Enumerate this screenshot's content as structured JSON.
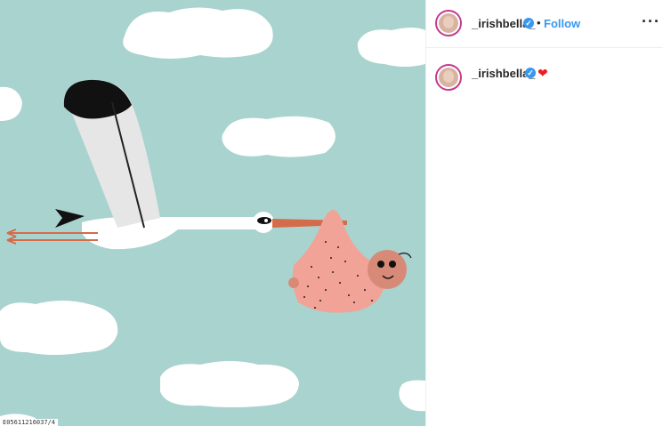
{
  "post": {
    "image_alt": "Stork carrying a baby in a bundle",
    "overlay_id": "E05611216037/4"
  },
  "header": {
    "username": "_irishbella_",
    "separator": "•",
    "follow_label": "Follow",
    "more_icon": "more-horizontal-icon",
    "more_label": "···"
  },
  "caption": {
    "username": "_irishbella_",
    "emoji": "❤"
  },
  "colors": {
    "sky": "#a9d3cf",
    "follow": "#3897f0",
    "verified": "#3897f0",
    "heart": "#ed1c24"
  }
}
